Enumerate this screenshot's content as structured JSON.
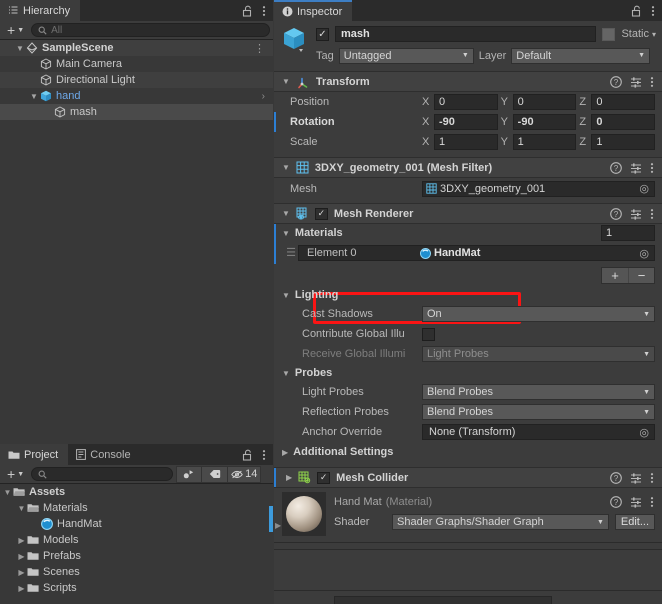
{
  "hierarchy": {
    "tab_label": "Hierarchy",
    "tab_icon": "hierarchy-icon",
    "lock_icon": "lock-open-icon",
    "menu_icon": "kebab-menu-icon",
    "add_label": "+",
    "search_placeholder": "All",
    "search_value": "",
    "rows": [
      {
        "label": "SampleScene",
        "depth": 0,
        "twisty": "▼",
        "icon": "scene-icon",
        "style": "scene",
        "kebab": true,
        "selected": false,
        "alt": true
      },
      {
        "label": "Main Camera",
        "depth": 1,
        "twisty": "",
        "icon": "gameobject-icon",
        "style": "normal",
        "kebab": false,
        "selected": false,
        "alt": false
      },
      {
        "label": "Directional Light",
        "depth": 1,
        "twisty": "",
        "icon": "gameobject-icon",
        "style": "normal",
        "kebab": false,
        "selected": false,
        "alt": true
      },
      {
        "label": "hand",
        "depth": 1,
        "twisty": "▼",
        "icon": "prefab-icon",
        "style": "prefab",
        "chev": "›",
        "selected": false,
        "alt": false
      },
      {
        "label": "mash",
        "depth": 2,
        "twisty": "",
        "icon": "gameobject-icon",
        "style": "normal",
        "kebab": false,
        "selected": true,
        "alt": false
      }
    ]
  },
  "project": {
    "tab_label": "Project",
    "tab_icon": "folder-icon",
    "console_tab_label": "Console",
    "console_tab_icon": "console-icon",
    "lock_icon": "lock-open-icon",
    "menu_icon": "kebab-menu-icon",
    "add_label": "+",
    "search_placeholder": "",
    "search_value": "",
    "filter_type_icon": "filter-by-type-icon",
    "filter_label_icon": "filter-by-label-icon",
    "hidden_icon": "eye-off-icon",
    "hidden_count": "14",
    "rows": [
      {
        "label": "Assets",
        "depth": 0,
        "twisty": "▼",
        "icon": "folder-open-icon",
        "bold": true
      },
      {
        "label": "Materials",
        "depth": 1,
        "twisty": "▼",
        "icon": "folder-open-icon",
        "bold": false
      },
      {
        "label": "HandMat",
        "depth": 2,
        "twisty": "",
        "icon": "material-icon",
        "bold": false
      },
      {
        "label": "Models",
        "depth": 1,
        "twisty": "▶",
        "icon": "folder-icon",
        "bold": false
      },
      {
        "label": "Prefabs",
        "depth": 1,
        "twisty": "▶",
        "icon": "folder-icon",
        "bold": false
      },
      {
        "label": "Scenes",
        "depth": 1,
        "twisty": "▶",
        "icon": "folder-icon",
        "bold": false
      },
      {
        "label": "Scripts",
        "depth": 1,
        "twisty": "▶",
        "icon": "folder-icon",
        "bold": false
      }
    ]
  },
  "inspector": {
    "tab_label": "Inspector",
    "tab_icon": "info-icon",
    "lock_icon": "lock-open-icon",
    "menu_icon": "kebab-menu-icon",
    "object": {
      "icon": "gameobject-cube-icon",
      "enabled_checkbox": "✓",
      "name": "mash",
      "static_checkbox": "",
      "static_label": "Static",
      "static_arrow": "▾",
      "tag_label": "Tag",
      "tag_value": "Untagged",
      "layer_label": "Layer",
      "layer_value": "Default"
    },
    "transform": {
      "title": "Transform",
      "icon": "transform-icon",
      "twisty": "▼",
      "help_icon": "help-icon",
      "preset_icon": "preset-icon",
      "menu_icon": "kebab-menu-icon",
      "rows": [
        {
          "label": "Position",
          "x": "0",
          "y": "0",
          "z": "0",
          "override": false
        },
        {
          "label": "Rotation",
          "x": "-90",
          "y": "-90",
          "z": "0",
          "override": true
        },
        {
          "label": "Scale",
          "x": "1",
          "y": "1",
          "z": "1",
          "override": false
        }
      ],
      "axis_x": "X",
      "axis_y": "Y",
      "axis_z": "Z"
    },
    "mesh_filter": {
      "title": "3DXY_geometry_001 (Mesh Filter)",
      "icon": "mesh-filter-icon",
      "twisty": "▼",
      "help_icon": "help-icon",
      "preset_icon": "preset-icon",
      "menu_icon": "kebab-menu-icon",
      "mesh_label": "Mesh",
      "mesh_value": "3DXY_geometry_001",
      "mesh_value_icon": "mesh-icon",
      "picker_icon": "object-picker-icon"
    },
    "mesh_renderer": {
      "title": "Mesh Renderer",
      "icon": "mesh-renderer-icon",
      "twisty": "▼",
      "enabled_checkbox": "✓",
      "help_icon": "help-icon",
      "preset_icon": "preset-icon",
      "menu_icon": "kebab-menu-icon",
      "materials": {
        "title": "Materials",
        "twisty": "▼",
        "size": "1",
        "element_label": "Element 0",
        "element_value": "HandMat",
        "element_value_icon": "material-icon",
        "drag_handle_icon": "drag-handle-icon",
        "picker_icon": "object-picker-icon",
        "add_label": "+",
        "remove_label": "−",
        "highlight_color": "#fb1414"
      },
      "lighting": {
        "title": "Lighting",
        "twisty": "▼",
        "rows": [
          {
            "label": "Cast Shadows",
            "kind": "dropdown",
            "value": "On",
            "disabled": false
          },
          {
            "label": "Contribute Global Illu",
            "kind": "checkbox",
            "value": "",
            "disabled": false
          },
          {
            "label": "Receive Global Illumi",
            "kind": "dropdown",
            "value": "Light Probes",
            "disabled": true
          }
        ]
      },
      "probes": {
        "title": "Probes",
        "twisty": "▼",
        "rows": [
          {
            "label": "Light Probes",
            "kind": "dropdown",
            "value": "Blend Probes",
            "disabled": false
          },
          {
            "label": "Reflection Probes",
            "kind": "dropdown",
            "value": "Blend Probes",
            "disabled": false
          },
          {
            "label": "Anchor Override",
            "kind": "objectfield",
            "value": "None (Transform)",
            "disabled": false
          }
        ]
      },
      "additional_settings": {
        "title": "Additional Settings",
        "twisty": "▶"
      }
    },
    "mesh_collider": {
      "title": "Mesh Collider",
      "icon": "mesh-collider-icon",
      "twisty": "▶",
      "enabled_checkbox": "✓",
      "help_icon": "help-icon",
      "preset_icon": "preset-icon",
      "menu_icon": "kebab-menu-icon"
    },
    "material_preview": {
      "name": "Hand Mat",
      "type_suffix": "(Material)",
      "preview_icon": "material-sphere-preview",
      "help_icon": "help-icon",
      "preset_icon": "preset-icon",
      "menu_icon": "kebab-menu-icon",
      "shader_label": "Shader",
      "shader_value": "Shader Graphs/Shader Graph",
      "edit_label": "Edit...",
      "expand_twisty": "▶"
    }
  },
  "colors": {
    "panel_bg": "#383838",
    "inspector_bg": "#3c3c3c",
    "tabbar_bg": "#2b2b2b",
    "field_bg": "#2a2a2a",
    "dropdown_bg": "#585858",
    "accent_blue": "#3d7ec4",
    "override_blue": "#2c7fd4",
    "prefab_blue": "#6ea8e8",
    "highlight_red": "#fb1414"
  }
}
